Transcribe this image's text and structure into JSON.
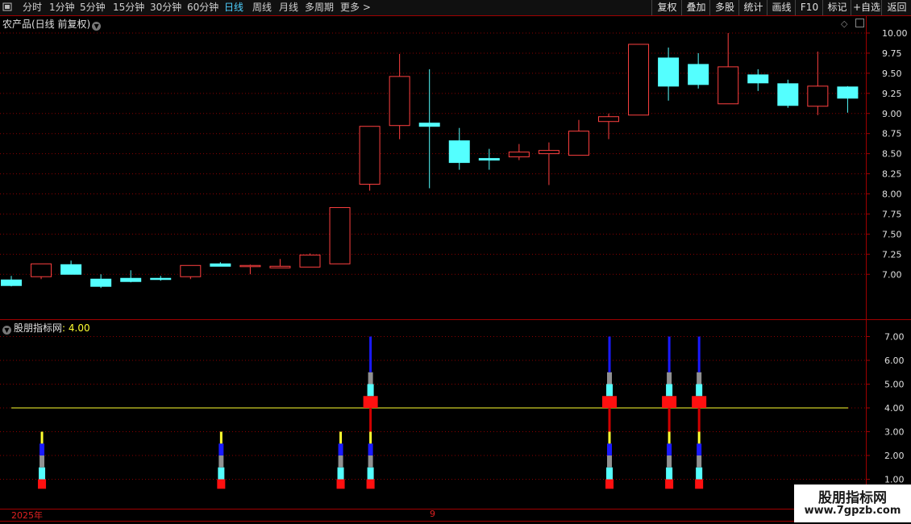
{
  "toolbar": {
    "menu_icon": "menu-icon",
    "periods": [
      "分时",
      "1分钟",
      "5分钟",
      "15分钟",
      "30分钟",
      "60分钟",
      "日线",
      "周线",
      "月线",
      "多周期",
      "更多"
    ],
    "active_period": "日线",
    "more_arrow": ">",
    "right_buttons": [
      "复权",
      "叠加",
      "多股",
      "统计",
      "画线",
      "F10",
      "标记",
      "+自选",
      "返回"
    ]
  },
  "main_pane": {
    "title": "农产品(日线 前复权)",
    "right_axis": [
      "10.00",
      "9.75",
      "9.50",
      "9.25",
      "9.00",
      "8.75",
      "8.50",
      "8.25",
      "8.00",
      "7.75",
      "7.50",
      "7.25",
      "7.00"
    ]
  },
  "indicator_pane": {
    "title": "股朋指标网",
    "value_label": ": 4.00",
    "right_axis": [
      "7.00",
      "6.00",
      "5.00",
      "4.00",
      "3.00",
      "2.00",
      "1.00"
    ]
  },
  "date_axis": {
    "labels": [
      "2025年",
      "9"
    ]
  },
  "watermark": {
    "line1": "股朋指标网",
    "line2": "www.7gpzb.com"
  },
  "colors": {
    "up": "#ff4040",
    "down": "#54ffff",
    "signal_line": "#ffff30",
    "grid": "#8b0000"
  },
  "chart_data": [
    {
      "type": "candlestick",
      "title": "农产品(日线 前复权)",
      "ylim": [
        6.6,
        10.05
      ],
      "candles": [
        {
          "o": 6.93,
          "c": 6.86,
          "h": 6.98,
          "l": 6.85
        },
        {
          "o": 6.97,
          "c": 7.13,
          "h": 7.13,
          "l": 6.94
        },
        {
          "o": 7.12,
          "c": 7.0,
          "h": 7.17,
          "l": 7.0
        },
        {
          "o": 6.94,
          "c": 6.85,
          "h": 7.0,
          "l": 6.83
        },
        {
          "o": 6.95,
          "c": 6.91,
          "h": 7.05,
          "l": 6.9
        },
        {
          "o": 6.95,
          "c": 6.94,
          "h": 6.98,
          "l": 6.92
        },
        {
          "o": 6.97,
          "c": 7.11,
          "h": 7.11,
          "l": 6.94
        },
        {
          "o": 7.13,
          "c": 7.1,
          "h": 7.15,
          "l": 7.1
        },
        {
          "o": 7.1,
          "c": 7.11,
          "h": 7.12,
          "l": 7.0
        },
        {
          "o": 7.08,
          "c": 7.1,
          "h": 7.19,
          "l": 7.08
        },
        {
          "o": 7.09,
          "c": 7.24,
          "h": 7.26,
          "l": 7.09
        },
        {
          "o": 7.13,
          "c": 7.83,
          "h": 7.83,
          "l": 7.13
        },
        {
          "o": 8.12,
          "c": 8.84,
          "h": 8.84,
          "l": 8.04
        },
        {
          "o": 8.85,
          "c": 9.46,
          "h": 9.74,
          "l": 8.68
        },
        {
          "o": 8.88,
          "c": 8.84,
          "h": 9.55,
          "l": 8.07
        },
        {
          "o": 8.66,
          "c": 8.39,
          "h": 8.82,
          "l": 8.3
        },
        {
          "o": 8.44,
          "c": 8.42,
          "h": 8.56,
          "l": 8.3
        },
        {
          "o": 8.46,
          "c": 8.52,
          "h": 8.62,
          "l": 8.42
        },
        {
          "o": 8.5,
          "c": 8.54,
          "h": 8.64,
          "l": 8.11
        },
        {
          "o": 8.48,
          "c": 8.78,
          "h": 8.92,
          "l": 8.48
        },
        {
          "o": 8.9,
          "c": 8.96,
          "h": 9.0,
          "l": 8.68
        },
        {
          "o": 8.98,
          "c": 9.86,
          "h": 9.86,
          "l": 8.98
        },
        {
          "o": 9.69,
          "c": 9.34,
          "h": 9.82,
          "l": 9.16
        },
        {
          "o": 9.61,
          "c": 9.36,
          "h": 9.75,
          "l": 9.31
        },
        {
          "o": 9.12,
          "c": 9.58,
          "h": 10.0,
          "l": 9.12
        },
        {
          "o": 9.48,
          "c": 9.38,
          "h": 9.55,
          "l": 9.28
        },
        {
          "o": 9.37,
          "c": 9.1,
          "h": 9.42,
          "l": 9.07
        },
        {
          "o": 9.09,
          "c": 9.34,
          "h": 9.77,
          "l": 8.98
        },
        {
          "o": 9.33,
          "c": 9.19,
          "h": 9.34,
          "l": 9.01
        }
      ]
    },
    {
      "type": "bar",
      "title": "股朋指标网",
      "ylim": [
        0.6,
        7.6
      ],
      "reference_line": 4.0,
      "signals": [
        {
          "index": 1,
          "top": 3.0
        },
        {
          "index": 7,
          "top": 3.0
        },
        {
          "index": 11,
          "top": 3.0
        },
        {
          "index": 12,
          "top": 7.0
        },
        {
          "index": 20,
          "top": 7.0
        },
        {
          "index": 22,
          "top": 7.0
        },
        {
          "index": 23,
          "top": 7.0
        }
      ]
    }
  ]
}
